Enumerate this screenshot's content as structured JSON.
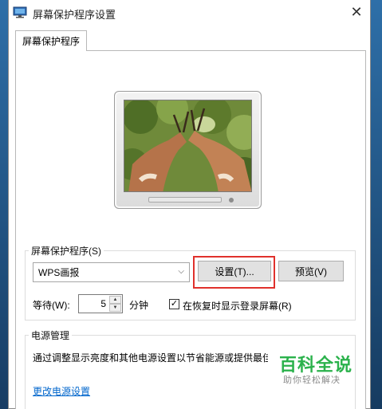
{
  "window": {
    "title": "屏幕保护程序设置",
    "close_glyph": "✕"
  },
  "tab": {
    "label": "屏幕保护程序"
  },
  "screensaver_group": {
    "label": "屏幕保护程序(S)",
    "selected": "WPS画报",
    "settings_button": "设置(T)...",
    "preview_button": "预览(V)",
    "wait_label": "等待(W):",
    "wait_value": "5",
    "wait_unit": "分钟",
    "resume_checkbox_checked": true,
    "resume_checkbox_label": "在恢复时显示登录屏幕(R)"
  },
  "power_group": {
    "label": "电源管理",
    "description": "通过调整显示亮度和其他电源设置以节省能源或提供最佳",
    "link": "更改电源设置"
  },
  "watermark": {
    "main": "百科全说",
    "sub": "助你轻松解决"
  },
  "colors": {
    "highlight_box": "#e0312c",
    "link": "#0066cc",
    "watermark": "#2bb24c"
  }
}
